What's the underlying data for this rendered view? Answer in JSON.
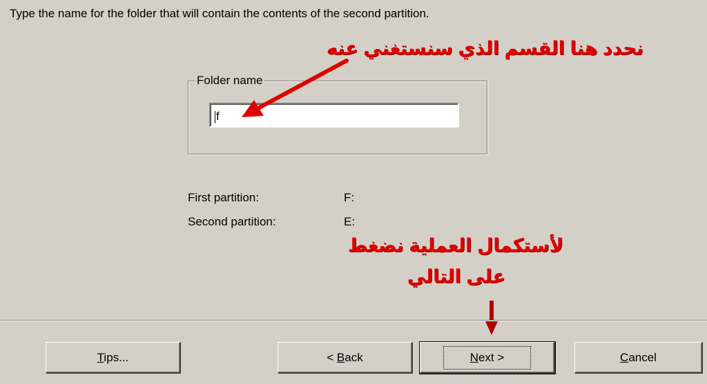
{
  "instruction": "Type the name for the folder that will contain the contents of the second partition.",
  "folder_group": {
    "legend": "Folder name",
    "value": "f"
  },
  "partitions": [
    {
      "label": "First partition:",
      "value": "F:"
    },
    {
      "label": "Second partition:",
      "value": "E:"
    }
  ],
  "annotations": {
    "top": "نحدد هنا القسم الذي سنستغني عنه",
    "bottom_line1": "لأستكمال العملية نضغط",
    "bottom_line2": "على التالي",
    "color": "#e00000"
  },
  "buttons": {
    "tips": {
      "mnemonic": "T",
      "rest": "ips..."
    },
    "back": {
      "prefix": "< ",
      "mnemonic": "B",
      "rest": "ack"
    },
    "next": {
      "mnemonic": "N",
      "rest": "ext >"
    },
    "cancel": {
      "mnemonic": "C",
      "rest": "ancel"
    }
  },
  "colors": {
    "dialog_bg": "#d4d0c8",
    "field_bg": "#ffffff",
    "annotation_red": "#e00000"
  }
}
